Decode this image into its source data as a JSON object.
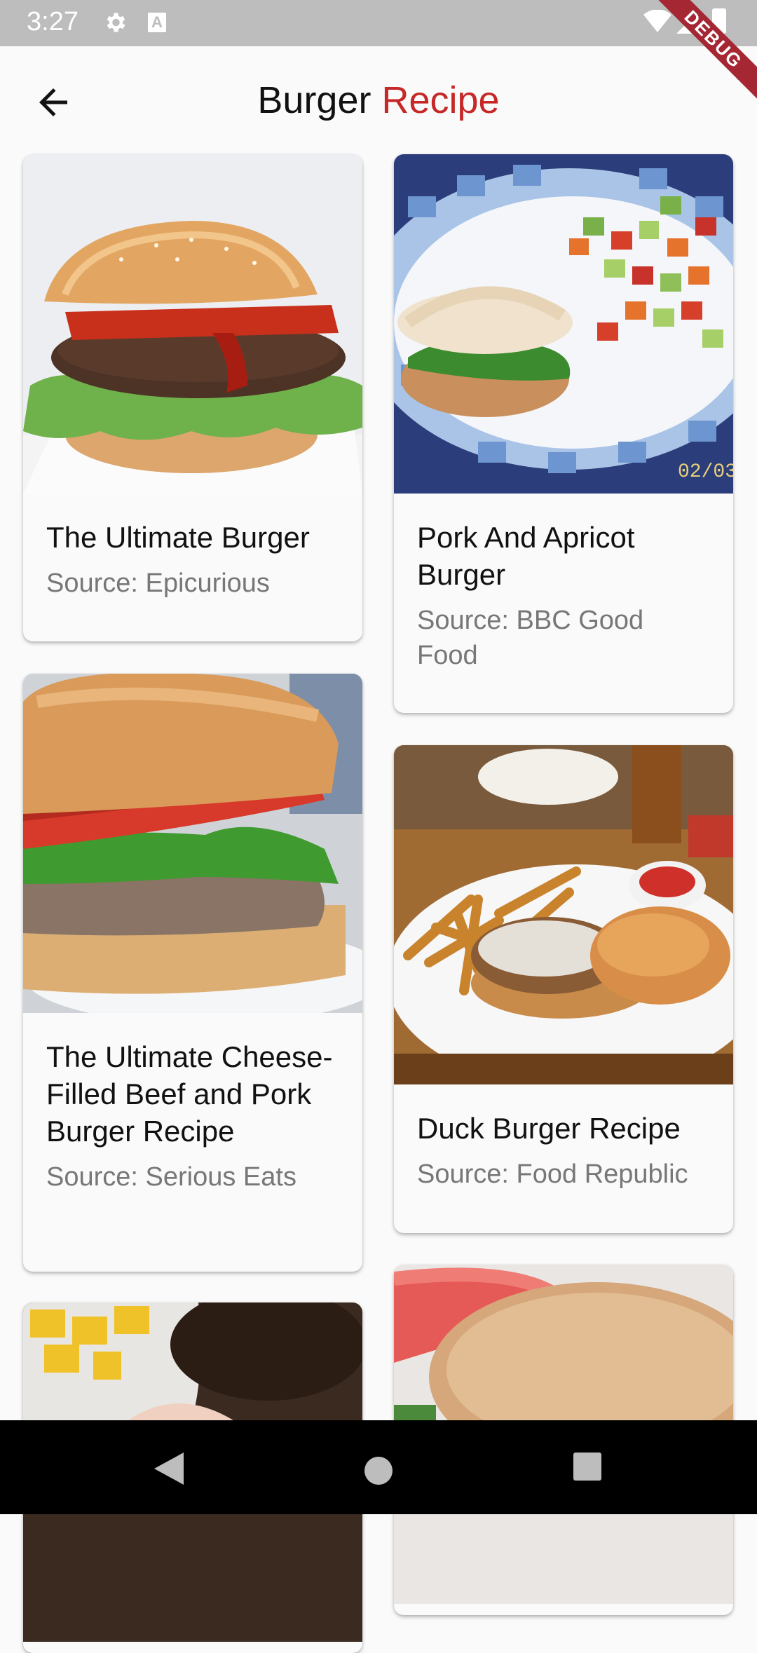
{
  "status_bar": {
    "time": "3:27",
    "gear_icon": "gear-icon",
    "a_icon_label": "A",
    "debug_label": "DEBUG"
  },
  "app_bar": {
    "title_part1": "Burger",
    "title_part2": "Recipe",
    "accent_color": "#c62828",
    "back_icon": "arrow-back-icon"
  },
  "recipes": [
    {
      "title": "The Ultimate Burger",
      "source": "Source: Epicurious"
    },
    {
      "title": "Pork And Apricot Burger",
      "source": "Source: BBC Good Food"
    },
    {
      "title": "The Ultimate Cheese-Filled Beef and Pork Burger Recipe",
      "source": "Source: Serious Eats"
    },
    {
      "title": "Duck Burger Recipe",
      "source": "Source: Food Republic"
    },
    {
      "title": "",
      "source": ""
    },
    {
      "title": "",
      "source": ""
    }
  ],
  "plate_date_text": "02/03",
  "nav_bar": {
    "back_icon": "nav-back-icon",
    "home_icon": "nav-home-icon",
    "recents_icon": "nav-recents-icon"
  }
}
